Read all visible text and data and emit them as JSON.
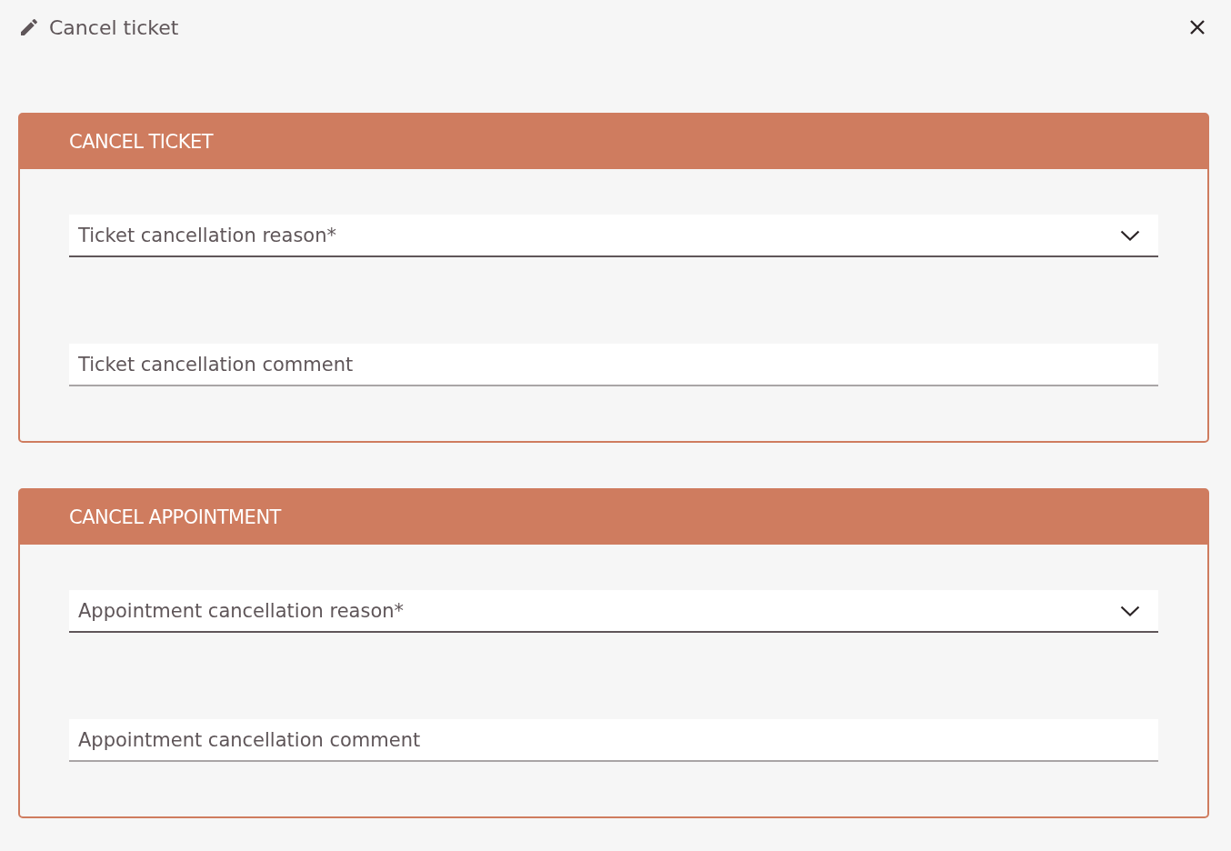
{
  "dialog": {
    "title": "Cancel ticket"
  },
  "sections": [
    {
      "title": "CANCEL TICKET",
      "fields": [
        {
          "kind": "select",
          "placeholder": "Ticket cancellation reason*"
        },
        {
          "kind": "text",
          "placeholder": "Ticket cancellation comment"
        }
      ]
    },
    {
      "title": "CANCEL APPOINTMENT",
      "fields": [
        {
          "kind": "select",
          "placeholder": "Appointment cancellation reason*"
        },
        {
          "kind": "text",
          "placeholder": "Appointment cancellation comment"
        }
      ]
    }
  ]
}
